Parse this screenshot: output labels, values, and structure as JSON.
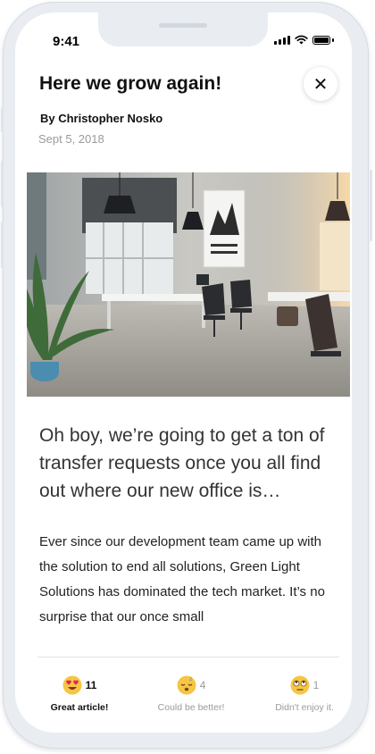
{
  "status_bar": {
    "time": "9:41"
  },
  "article": {
    "title": "Here we grow again!",
    "author": "By Christopher Nosko",
    "date": "Sept 5, 2018",
    "lead": "Oh boy, we’re going to get a ton of transfer requests once you all find out where our new office is…",
    "body": "Ever since our development team came up with the solution to end all solutions, Green Light Solutions has dominated the tech market. It’s no surprise that our once small"
  },
  "icons": {
    "close": "close-icon",
    "hero": "office-photo"
  },
  "reactions": [
    {
      "emoji": "heart-eyes-icon",
      "count": "11",
      "label": "Great article!",
      "selected": true
    },
    {
      "emoji": "sleeping-icon",
      "count": "4",
      "label": "Could be better!",
      "selected": false
    },
    {
      "emoji": "eye-roll-icon",
      "count": "1",
      "label": "Didn't enjoy it.",
      "selected": false
    }
  ],
  "colors": {
    "text": "#111111",
    "muted": "#9a9a9a",
    "emoji": "#f6c543"
  }
}
